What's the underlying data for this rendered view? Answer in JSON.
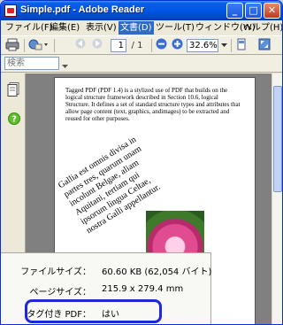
{
  "window": {
    "title": "Simple.pdf - Adobe Reader",
    "buttons": {
      "minimize": "_",
      "maximize": "□",
      "close": "✕"
    }
  },
  "menubar": {
    "items": [
      {
        "label": "ファイル(F)"
      },
      {
        "label": "編集(E)"
      },
      {
        "label": "表示(V)"
      },
      {
        "label": "文書(D)"
      },
      {
        "label": "ツール(T)"
      },
      {
        "label": "ウィンドウ(W)"
      },
      {
        "label": "ヘルプ(H)"
      }
    ]
  },
  "toolbar": {
    "current_page": "1",
    "total_pages": "/ 1",
    "zoom": "32.6%"
  },
  "search": {
    "placeholder": "検索"
  },
  "document": {
    "paragraph": "Tagged PDF (PDF 1.4) is a stylized use of PDF that builds on the logical structure framework described in Section 10.6, logical Structure. It defines a set of standard structure types and attributes that allow page content (text, graphics, andimages) to be extracted and reused for other purposes.",
    "rotated_lines": [
      "Gallia est omnis divisa in",
      "partes tres, quarum unam",
      "incolunt Belgae, aliam",
      "Aquitani, tertiam qui",
      "ipsorum lingua Celtae,",
      "nostra Galli appellantur."
    ]
  },
  "tooltip": {
    "file_size_label": "ファイルサイズ：",
    "file_size_value": "60.60 KB (62,054 バイト)",
    "page_size_label": "ページサイズ：",
    "page_size_value": "215.9 x 279.4 mm",
    "tagged_label": "タグ付き PDF：",
    "tagged_value": "はい"
  },
  "colors": {
    "title_bar": "#0055e5",
    "highlight": "#1e28d6",
    "menu_active": "#316ac5"
  }
}
